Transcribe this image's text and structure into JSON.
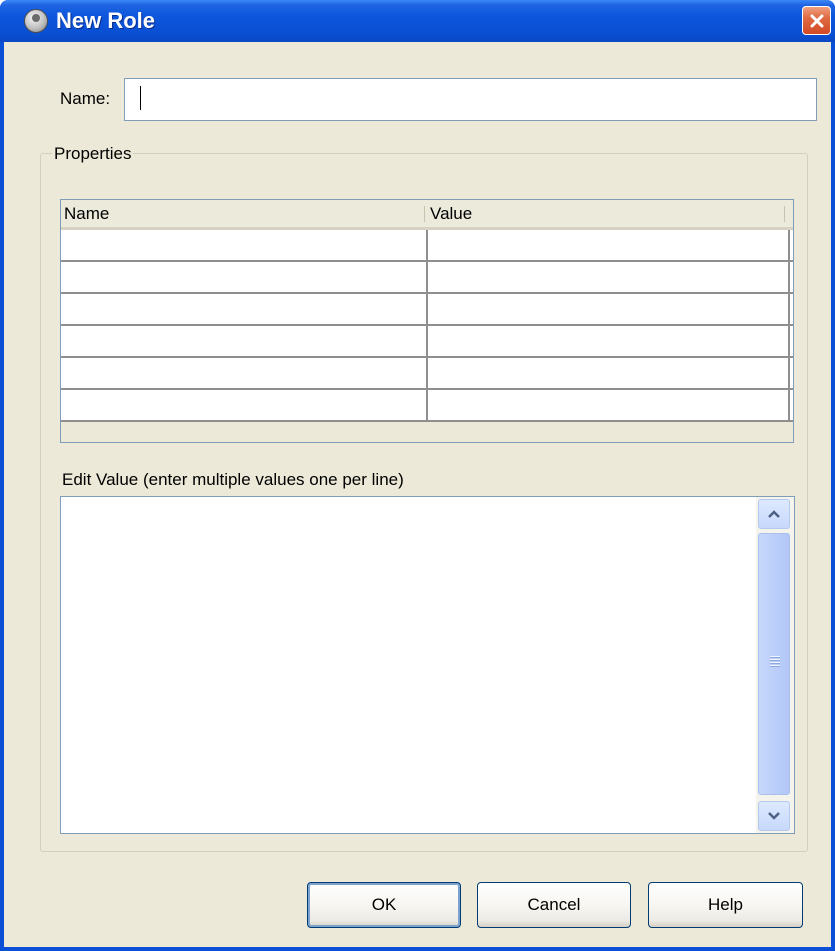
{
  "window": {
    "title": "New Role"
  },
  "form": {
    "name_label": "Name:",
    "name_value": "",
    "name_placeholder": ""
  },
  "properties": {
    "group_title": "Properties",
    "columns": [
      "Name",
      "Value"
    ],
    "rows": [
      [
        "",
        ""
      ],
      [
        "",
        ""
      ],
      [
        "",
        ""
      ],
      [
        "",
        ""
      ],
      [
        "",
        ""
      ],
      [
        "",
        ""
      ]
    ],
    "edit_label": "Edit Value (enter multiple values one per line)",
    "edit_value": ""
  },
  "buttons": {
    "ok": "OK",
    "cancel": "Cancel",
    "help": "Help"
  },
  "colors": {
    "titlebar": "#0a4fd6",
    "window_bg": "#ece9d8",
    "close": "#d24a24"
  },
  "icons": [
    "role-icon",
    "close-icon",
    "scroll-up-icon",
    "scroll-down-icon"
  ]
}
